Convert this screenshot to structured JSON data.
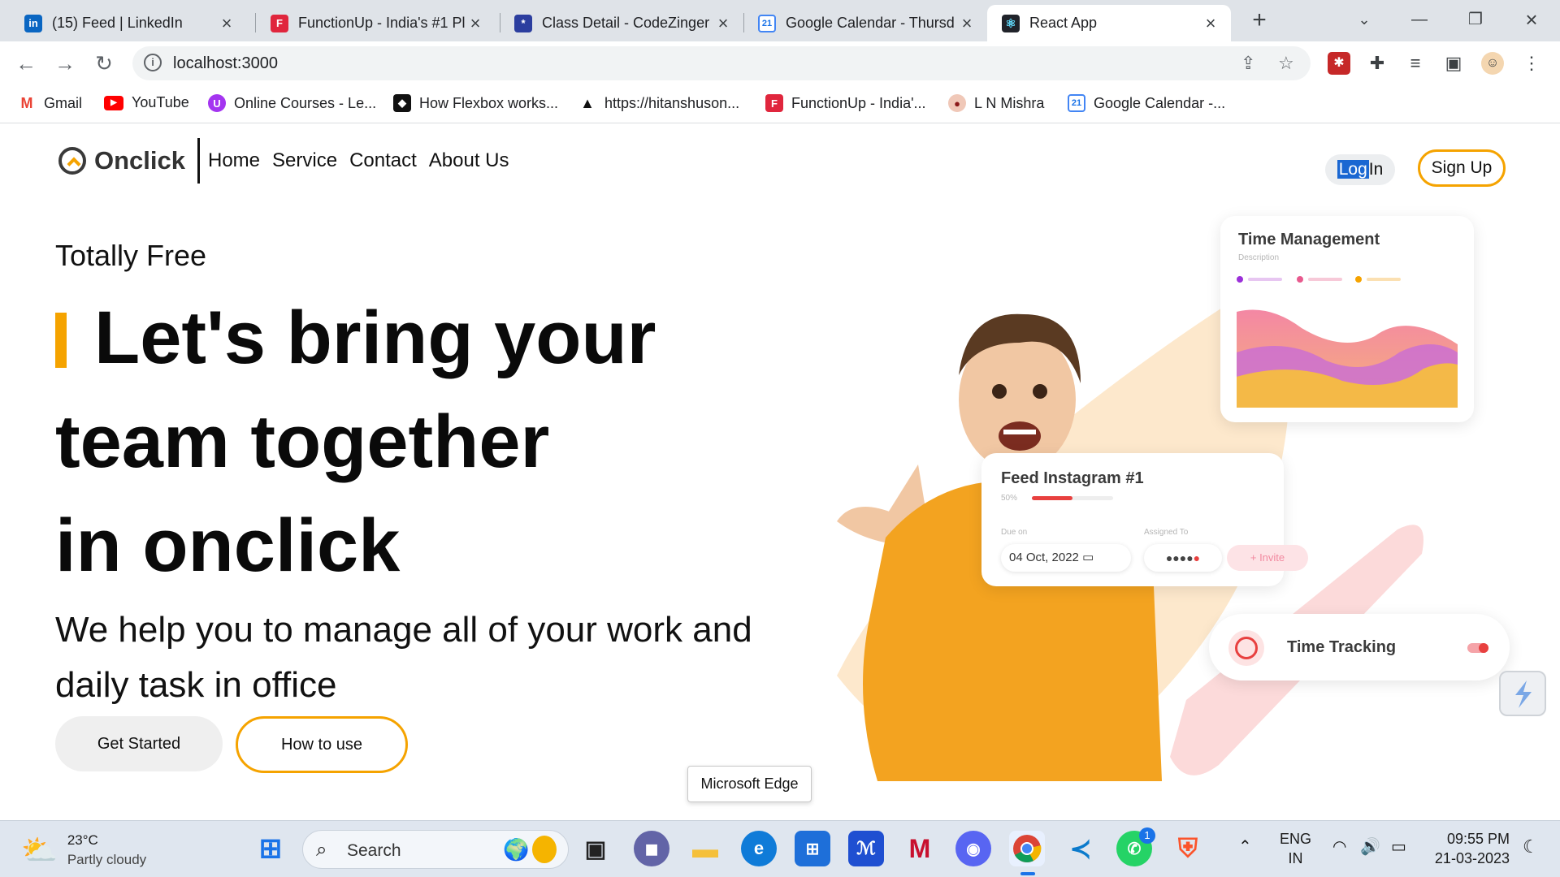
{
  "browser": {
    "tabs": [
      {
        "title": "(15) Feed | LinkedIn",
        "icon": "linkedin-icon"
      },
      {
        "title": "FunctionUp - India's #1 Pl",
        "icon": "functionup-icon"
      },
      {
        "title": "Class Detail - CodeZinger",
        "icon": "codezinger-icon"
      },
      {
        "title": "Google Calendar - Thursd",
        "icon": "google-calendar-icon"
      },
      {
        "title": "React App",
        "icon": "react-icon"
      }
    ],
    "calendar_badge": "21",
    "address": "localhost:3000",
    "bookmarks": [
      {
        "label": "Gmail",
        "icon": "gmail-icon"
      },
      {
        "label": "YouTube",
        "icon": "youtube-icon"
      },
      {
        "label": "Online Courses - Le...",
        "icon": "udemy-icon"
      },
      {
        "label": "How Flexbox works...",
        "icon": "flexbox-icon"
      },
      {
        "label": "https://hitanshuson...",
        "icon": "triangle-icon"
      },
      {
        "label": "FunctionUp - India'...",
        "icon": "functionup-icon"
      },
      {
        "label": "L N Mishra",
        "icon": "college-icon"
      },
      {
        "label": "Google Calendar -...",
        "icon": "google-calendar-icon"
      }
    ]
  },
  "site": {
    "brand": "Onclick",
    "nav": [
      "Home",
      "Service",
      "Contact",
      "About Us"
    ],
    "login_selected": "Log",
    "login_rest": "In",
    "signup": "Sign Up",
    "eyebrow": "Totally Free",
    "headline_line1": "Let's bring your",
    "headline_line2": "team together",
    "headline_line3": "in onclick",
    "subtitle": "We help you to manage all of your work and daily task in office",
    "cta_primary": "Get Started",
    "cta_secondary": "How to use",
    "hero": {
      "card1_title": "Time Management",
      "card1_sub": "Description",
      "card2_title": "Feed Instagram #1",
      "card2_progress": "50%",
      "card2_due_label": "Due on",
      "card2_due": "04 Oct, 2022",
      "card2_assigned_label": "Assigned To",
      "card2_invite": "+ Invite",
      "card3_title": "Time Tracking"
    }
  },
  "tooltip": "Microsoft Edge",
  "taskbar": {
    "temperature": "23°C",
    "condition": "Partly cloudy",
    "search_placeholder": "Search",
    "whatsapp_badge": "1",
    "language_line1": "ENG",
    "language_line2": "IN",
    "time": "09:55 PM",
    "date": "21-03-2023"
  },
  "colors": {
    "accent": "#f5a300",
    "selection": "#1a67d2",
    "tabbar": "#dfe3e8",
    "taskbar": "#dfe6ef"
  }
}
